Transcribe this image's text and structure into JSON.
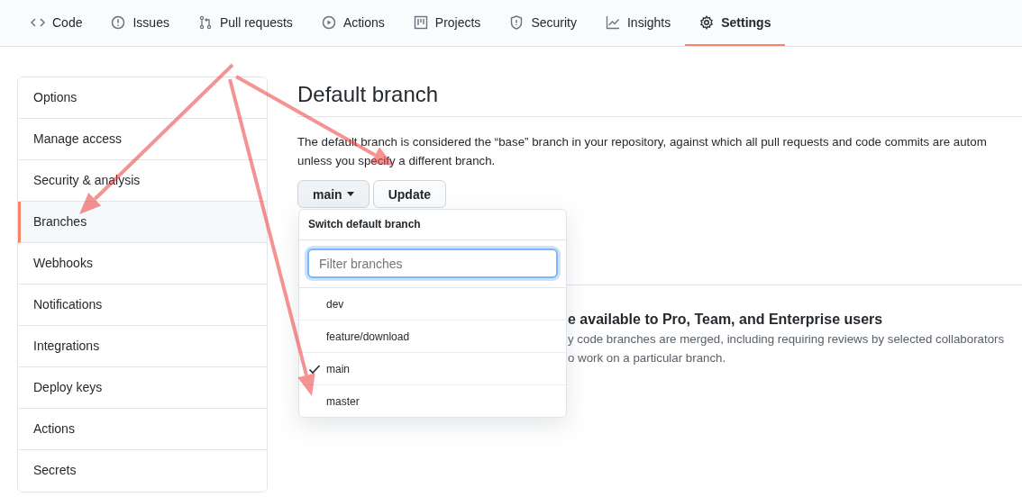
{
  "tabs": [
    {
      "label": "Code",
      "selected": false
    },
    {
      "label": "Issues",
      "selected": false
    },
    {
      "label": "Pull requests",
      "selected": false
    },
    {
      "label": "Actions",
      "selected": false
    },
    {
      "label": "Projects",
      "selected": false
    },
    {
      "label": "Security",
      "selected": false
    },
    {
      "label": "Insights",
      "selected": false
    },
    {
      "label": "Settings",
      "selected": true
    }
  ],
  "sidebar": {
    "items": [
      {
        "label": "Options",
        "selected": false
      },
      {
        "label": "Manage access",
        "selected": false
      },
      {
        "label": "Security & analysis",
        "selected": false
      },
      {
        "label": "Branches",
        "selected": true
      },
      {
        "label": "Webhooks",
        "selected": false
      },
      {
        "label": "Notifications",
        "selected": false
      },
      {
        "label": "Integrations",
        "selected": false
      },
      {
        "label": "Deploy keys",
        "selected": false
      },
      {
        "label": "Actions",
        "selected": false
      },
      {
        "label": "Secrets",
        "selected": false
      }
    ]
  },
  "default_branch": {
    "title": "Default branch",
    "description": "The default branch is considered the “base” branch in your repository, against which all pull requests and code commits are autom",
    "description_2": "unless you specify a different branch.",
    "branch_button": "main",
    "update_button": "Update"
  },
  "dropdown": {
    "title": "Switch default branch",
    "filter": {
      "placeholder": "Filter branches"
    },
    "items": [
      {
        "label": "dev",
        "selected": false
      },
      {
        "label": "feature/download",
        "selected": false
      },
      {
        "label": "main",
        "selected": true
      },
      {
        "label": "master",
        "selected": false
      }
    ]
  },
  "protection": {
    "heading": "e available to Pro, Team, and Enterprise users",
    "lines": [
      "y code branches are merged, including requiring reviews by selected collaborators",
      "o work on a particular branch."
    ]
  },
  "annotations": [
    {
      "kind": "arrow"
    },
    {
      "kind": "arrow"
    },
    {
      "kind": "arrow"
    }
  ]
}
